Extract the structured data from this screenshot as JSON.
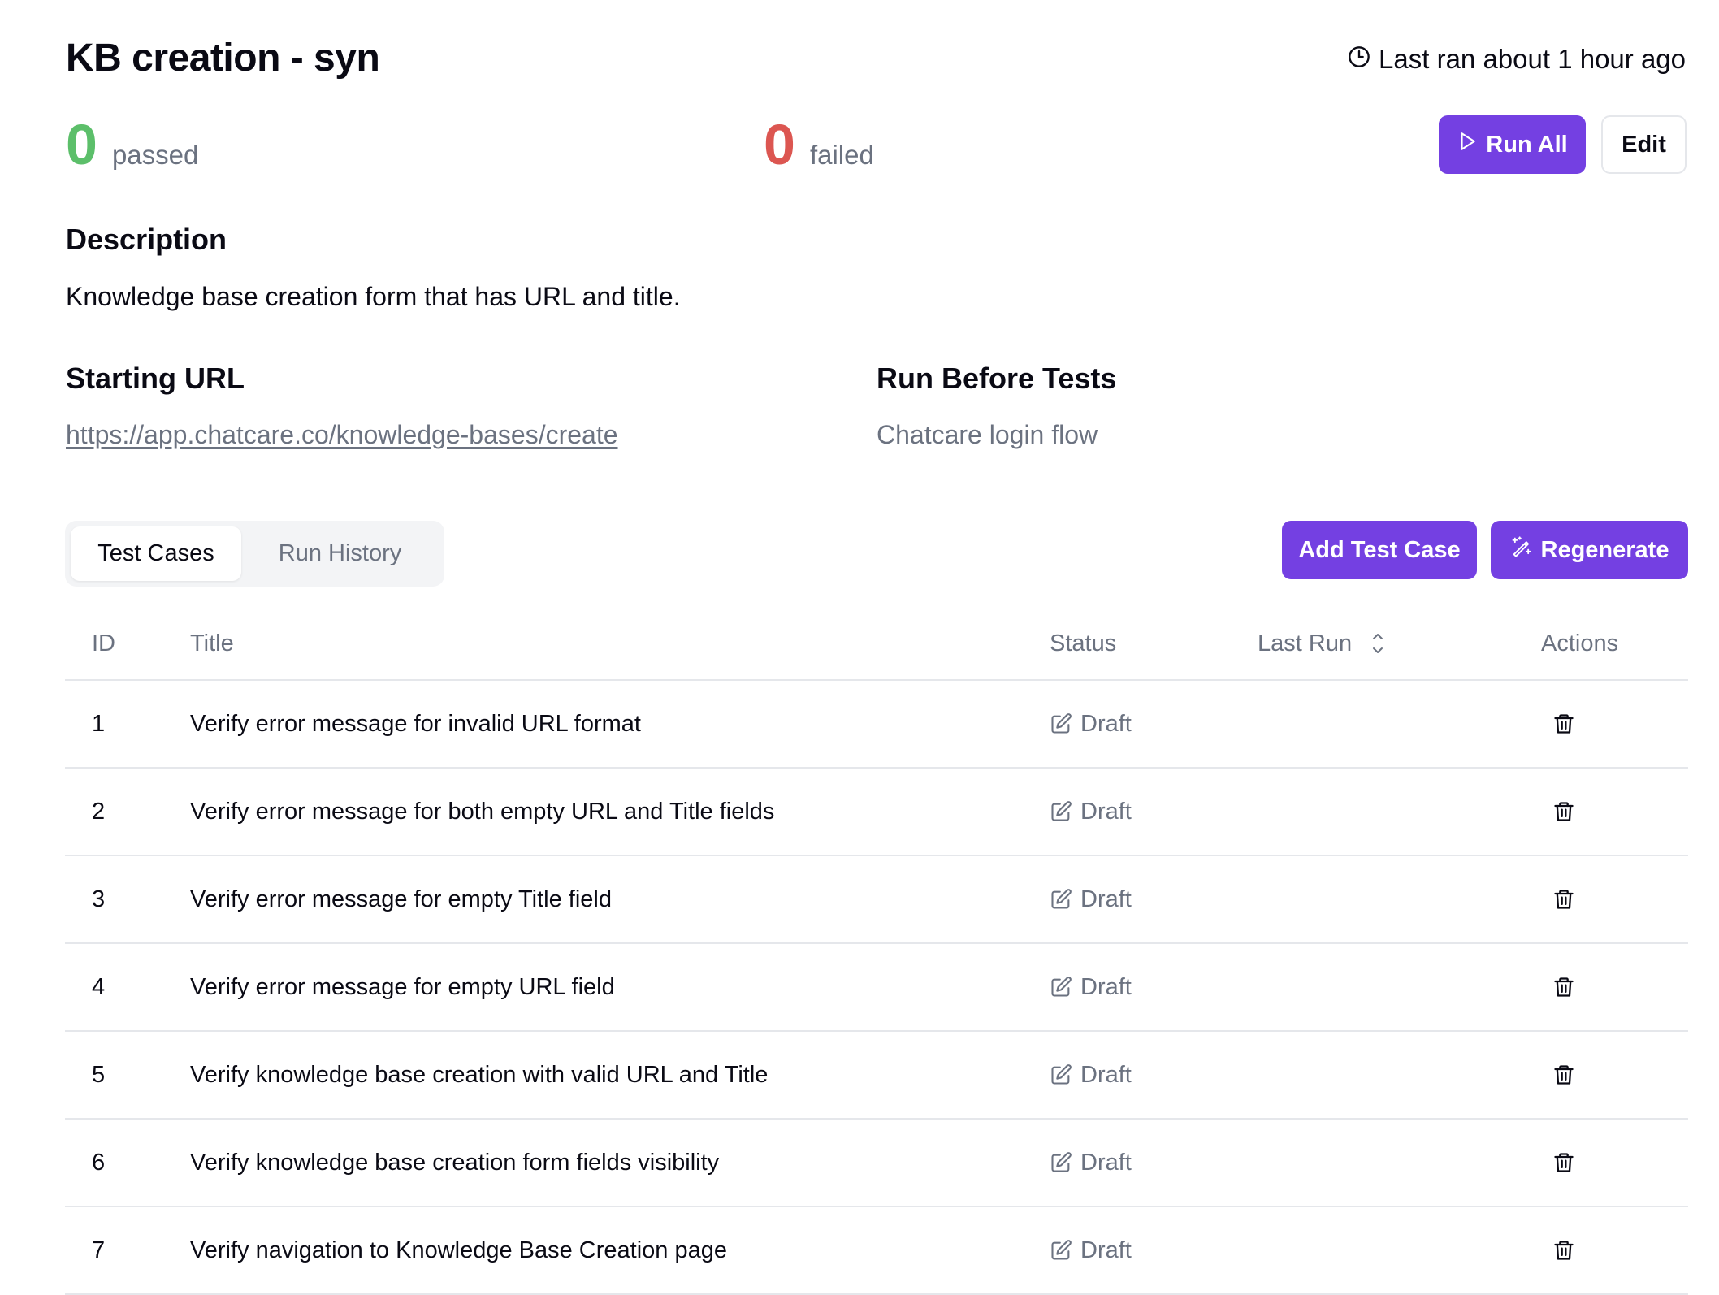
{
  "header": {
    "title": "KB creation - syn",
    "last_ran": "Last ran about 1 hour ago",
    "clock_icon": "clock-icon"
  },
  "stats": {
    "passed": {
      "count": "0",
      "label": "passed",
      "color": "#5cbf6a"
    },
    "failed": {
      "count": "0",
      "label": "failed",
      "color": "#dc5651"
    }
  },
  "toolbar": {
    "run_all_label": "Run All",
    "run_all_icon": "play-icon",
    "edit_label": "Edit"
  },
  "description": {
    "heading": "Description",
    "text": "Knowledge base creation form that has URL and title."
  },
  "starting_url": {
    "heading": "Starting URL",
    "value": "https://app.chatcare.co/knowledge-bases/create"
  },
  "run_before": {
    "heading": "Run Before Tests",
    "value": "Chatcare login flow"
  },
  "tabs": [
    {
      "label": "Test Cases",
      "active": true
    },
    {
      "label": "Run History",
      "active": false
    }
  ],
  "actions": {
    "add_test_case_label": "Add Test Case",
    "regenerate_label": "Regenerate",
    "regenerate_icon": "magic-wand-icon"
  },
  "accent_color": "#7440e2",
  "table": {
    "columns": [
      "ID",
      "Title",
      "Status",
      "Last Run",
      "Actions"
    ],
    "rows": [
      {
        "id": "1",
        "title": "Verify error message for invalid URL format",
        "status": "Draft",
        "last_run": ""
      },
      {
        "id": "2",
        "title": "Verify error message for both empty URL and Title fields",
        "status": "Draft",
        "last_run": ""
      },
      {
        "id": "3",
        "title": "Verify error message for empty Title field",
        "status": "Draft",
        "last_run": ""
      },
      {
        "id": "4",
        "title": "Verify error message for empty URL field",
        "status": "Draft",
        "last_run": ""
      },
      {
        "id": "5",
        "title": "Verify knowledge base creation with valid URL and Title",
        "status": "Draft",
        "last_run": ""
      },
      {
        "id": "6",
        "title": "Verify knowledge base creation form fields visibility",
        "status": "Draft",
        "last_run": ""
      },
      {
        "id": "7",
        "title": "Verify navigation to Knowledge Base Creation page",
        "status": "Draft",
        "last_run": ""
      }
    ]
  }
}
